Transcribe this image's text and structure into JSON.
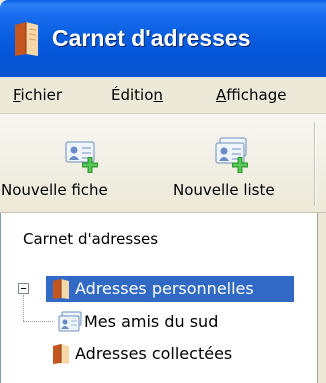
{
  "window": {
    "title": "Carnet d'adresses",
    "app_icon": "address-book-icon"
  },
  "menu": {
    "items": [
      {
        "accel": "F",
        "rest": "ichier"
      },
      {
        "pre": "Éditio",
        "accel": "n"
      },
      {
        "accel": "A",
        "rest": "ffichage"
      }
    ]
  },
  "toolbar": {
    "buttons": [
      {
        "label": "Nouvelle fiche",
        "icon": "new-card-icon"
      },
      {
        "label": "Nouvelle liste",
        "icon": "new-list-icon"
      }
    ]
  },
  "panel": {
    "header": "Carnet d'adresses"
  },
  "tree": {
    "items": [
      {
        "label": "Adresses personnelles",
        "icon": "address-book-icon",
        "selected": true,
        "expanded": true
      },
      {
        "label": "Mes amis du sud",
        "icon": "mailing-list-icon"
      },
      {
        "label": "Adresses collectées",
        "icon": "address-book-icon"
      }
    ]
  },
  "colors": {
    "title_bar": "#0a5ee0",
    "selection": "#316ac5",
    "window_bg": "#ece9d8"
  }
}
